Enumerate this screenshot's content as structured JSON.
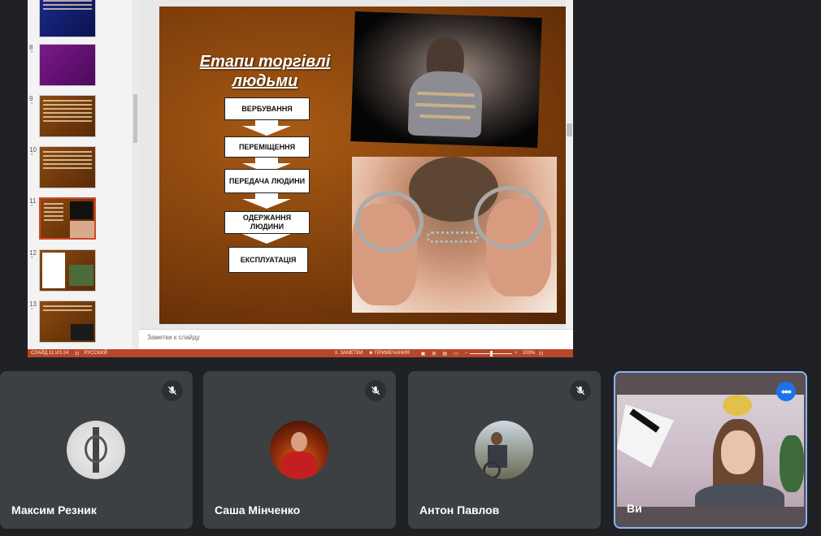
{
  "presentation": {
    "slide_title": "Етапи торгівлі людьми",
    "stages": [
      "ВЕРБУВАННЯ",
      "ПЕРЕМІЩЕННЯ",
      "ПЕРЕДАЧА   ЛЮДИНИ",
      "ОДЕРЖАННЯ ЛЮДИНИ",
      "ЕКСПЛУАТАЦІЯ"
    ],
    "notes_placeholder": "Заметки к слайду",
    "thumbnails": [
      {
        "num": "",
        "star": ""
      },
      {
        "num": "8",
        "star": "*"
      },
      {
        "num": "9",
        "star": "*"
      },
      {
        "num": "10",
        "star": "*"
      },
      {
        "num": "11",
        "star": "*"
      },
      {
        "num": "12",
        "star": "*"
      },
      {
        "num": "13",
        "star": "*"
      }
    ],
    "status": {
      "slide_info": "СЛАЙД 11 ИЗ 24",
      "language": "РУССКИЙ",
      "notes_btn": "ЗАМЕТКИ",
      "comments_btn": "ПРИМЕЧАНИЯ",
      "zoom": "103%"
    }
  },
  "participants": [
    {
      "name": "Максим Резник",
      "muted": true
    },
    {
      "name": "Саша Мінченко",
      "muted": true
    },
    {
      "name": "Антон Павлов",
      "muted": true
    }
  ],
  "self_tile": {
    "name": "Ви",
    "more_label": "•••"
  },
  "colors": {
    "tile_bg": "#3c4043",
    "page_bg": "#202124",
    "accent": "#1a73e8",
    "self_border": "#8ab4f8"
  }
}
